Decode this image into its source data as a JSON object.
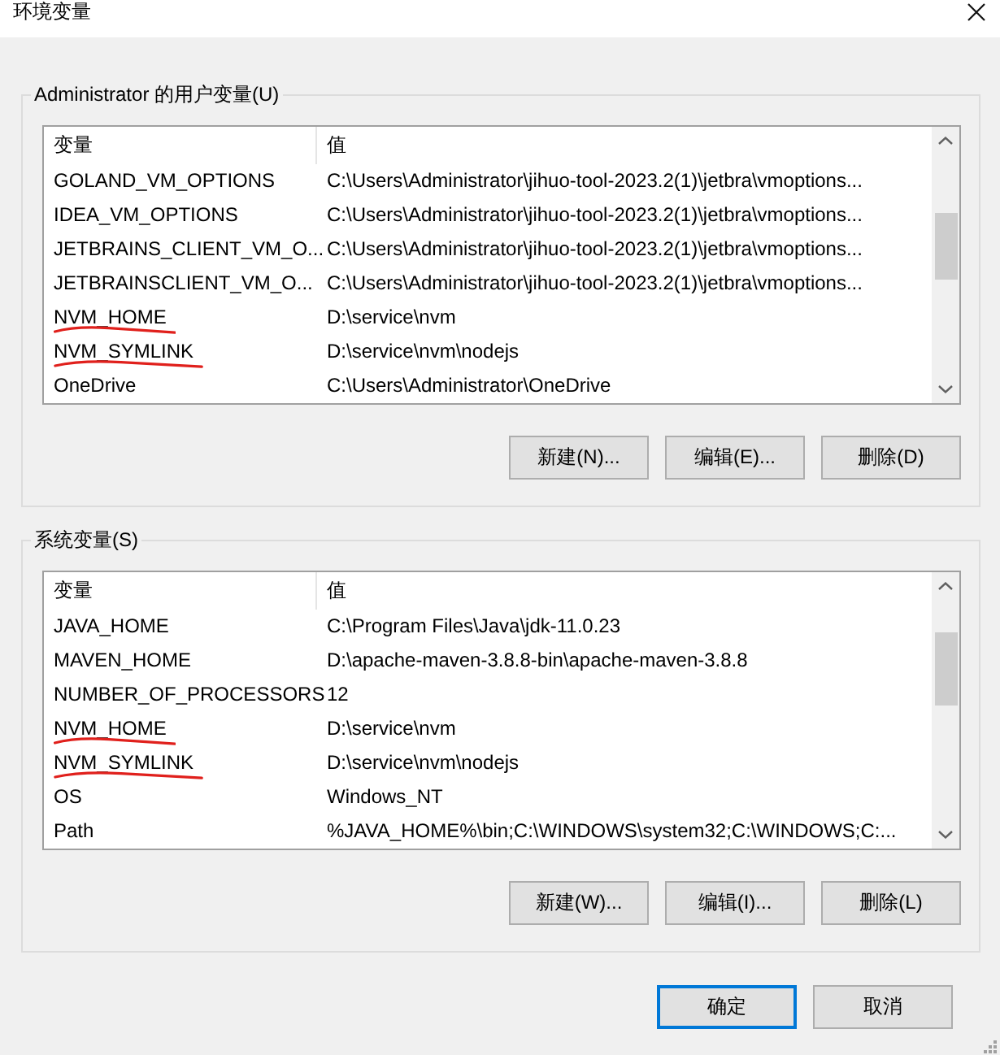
{
  "window": {
    "title": "环境变量"
  },
  "user_variables": {
    "label": "Administrator 的用户变量(U)",
    "columns": [
      "变量",
      "值"
    ],
    "rows": [
      {
        "name": "GOLAND_VM_OPTIONS",
        "value": "C:\\Users\\Administrator\\jihuo-tool-2023.2(1)\\jetbra\\vmoptions...",
        "marked": false
      },
      {
        "name": "IDEA_VM_OPTIONS",
        "value": "C:\\Users\\Administrator\\jihuo-tool-2023.2(1)\\jetbra\\vmoptions...",
        "marked": false
      },
      {
        "name": "JETBRAINS_CLIENT_VM_O...",
        "value": "C:\\Users\\Administrator\\jihuo-tool-2023.2(1)\\jetbra\\vmoptions...",
        "marked": false
      },
      {
        "name": "JETBRAINSCLIENT_VM_O...",
        "value": "C:\\Users\\Administrator\\jihuo-tool-2023.2(1)\\jetbra\\vmoptions...",
        "marked": false
      },
      {
        "name": "NVM_HOME",
        "value": "D:\\service\\nvm",
        "marked": true
      },
      {
        "name": "NVM_SYMLINK",
        "value": "D:\\service\\nvm\\nodejs",
        "marked": true
      },
      {
        "name": "OneDrive",
        "value": "C:\\Users\\Administrator\\OneDrive",
        "marked": false
      }
    ],
    "buttons": [
      "新建(N)...",
      "编辑(E)...",
      "删除(D)"
    ]
  },
  "system_variables": {
    "label": "系统变量(S)",
    "columns": [
      "变量",
      "值"
    ],
    "rows": [
      {
        "name": "JAVA_HOME",
        "value": "C:\\Program Files\\Java\\jdk-11.0.23",
        "marked": false
      },
      {
        "name": "MAVEN_HOME",
        "value": "D:\\apache-maven-3.8.8-bin\\apache-maven-3.8.8",
        "marked": false
      },
      {
        "name": "NUMBER_OF_PROCESSORS",
        "value": "12",
        "marked": false
      },
      {
        "name": "NVM_HOME",
        "value": "D:\\service\\nvm",
        "marked": true
      },
      {
        "name": "NVM_SYMLINK",
        "value": "D:\\service\\nvm\\nodejs",
        "marked": true
      },
      {
        "name": "OS",
        "value": "Windows_NT",
        "marked": false
      },
      {
        "name": "Path",
        "value": "%JAVA_HOME%\\bin;C:\\WINDOWS\\system32;C:\\WINDOWS;C:...",
        "marked": false
      }
    ],
    "buttons": [
      "新建(W)...",
      "编辑(I)...",
      "删除(L)"
    ]
  },
  "dialog_buttons": [
    {
      "label": "确定",
      "default": true
    },
    {
      "label": "取消",
      "default": false
    }
  ]
}
